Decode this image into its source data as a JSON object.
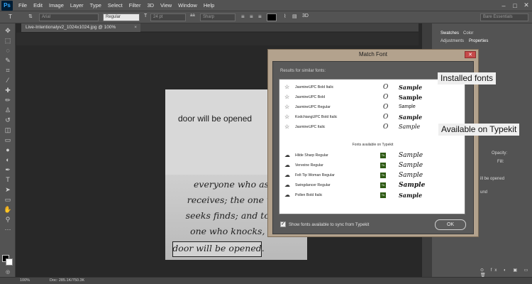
{
  "app": {
    "logo": "Ps"
  },
  "menu": [
    "File",
    "Edit",
    "Image",
    "Layer",
    "Type",
    "Select",
    "Filter",
    "3D",
    "View",
    "Window",
    "Help"
  ],
  "window_controls": [
    "–",
    "□",
    "✕"
  ],
  "options_bar": {
    "font_family": "Arial",
    "font_style": "Regular",
    "font_size": "24 pt",
    "antialias": "Sharp",
    "workspace": "Bare Essentials"
  },
  "document_tab": {
    "title": "Live-Intentionalyv2_1024x1024.jpg @ 100% (RGB/8#) *",
    "close": "×"
  },
  "canvas": {
    "top_text": "door will be opened",
    "scripture_lines": [
      "everyone who asks",
      "receives; the one who",
      "seeks finds; and to the",
      "one who knocks, the",
      "door will be opened."
    ]
  },
  "status_bar": {
    "zoom": "100%",
    "doc_info": "Doc: 285.1K/750.3K"
  },
  "right_panel": {
    "tabs_top": [
      "Swatches",
      "Color"
    ],
    "tabs_bottom": [
      "Adjustments",
      "Properties"
    ],
    "opacity_label": "Opacity:",
    "fill_label": "Fill:",
    "layer_name": "ill be opened",
    "layer_name2": "und"
  },
  "dialog": {
    "title": "Match Font",
    "close": "✕",
    "results_label": "Results for similar fonts:",
    "installed_fonts": [
      {
        "name": "JasmineUPC Bold Italic",
        "glyph": "O",
        "sample": "Sample"
      },
      {
        "name": "JasmineUPC Bold",
        "glyph": "O",
        "sample": "Sample"
      },
      {
        "name": "JasmineUPC Regular",
        "glyph": "O",
        "sample": "Sample"
      },
      {
        "name": "KodchiangUPC Bold Italic",
        "glyph": "O",
        "sample": "Sample"
      },
      {
        "name": "JasmineUPC Italic",
        "glyph": "O",
        "sample": "Sample"
      }
    ],
    "typekit_header": "Fonts available on Typekit",
    "typekit_fonts": [
      {
        "name": "Hilde Sharp Regular",
        "badge": "Tk",
        "sample": "Sample"
      },
      {
        "name": "Verveine Regular",
        "badge": "Tk",
        "sample": "Sample"
      },
      {
        "name": "Felt Tip Woman Regular",
        "badge": "Tk",
        "sample": "Sample"
      },
      {
        "name": "Swingdancer Regular",
        "badge": "Tk",
        "sample": "Sample"
      },
      {
        "name": "Pollen Bold Italic",
        "badge": "Tk",
        "sample": "Sample"
      }
    ],
    "sync_label": "Show fonts available to sync from Typekit",
    "sync_checked": "✓",
    "ok_label": "OK"
  },
  "callouts": {
    "installed": "Installed fonts",
    "typekit": "Available on Typekit"
  }
}
